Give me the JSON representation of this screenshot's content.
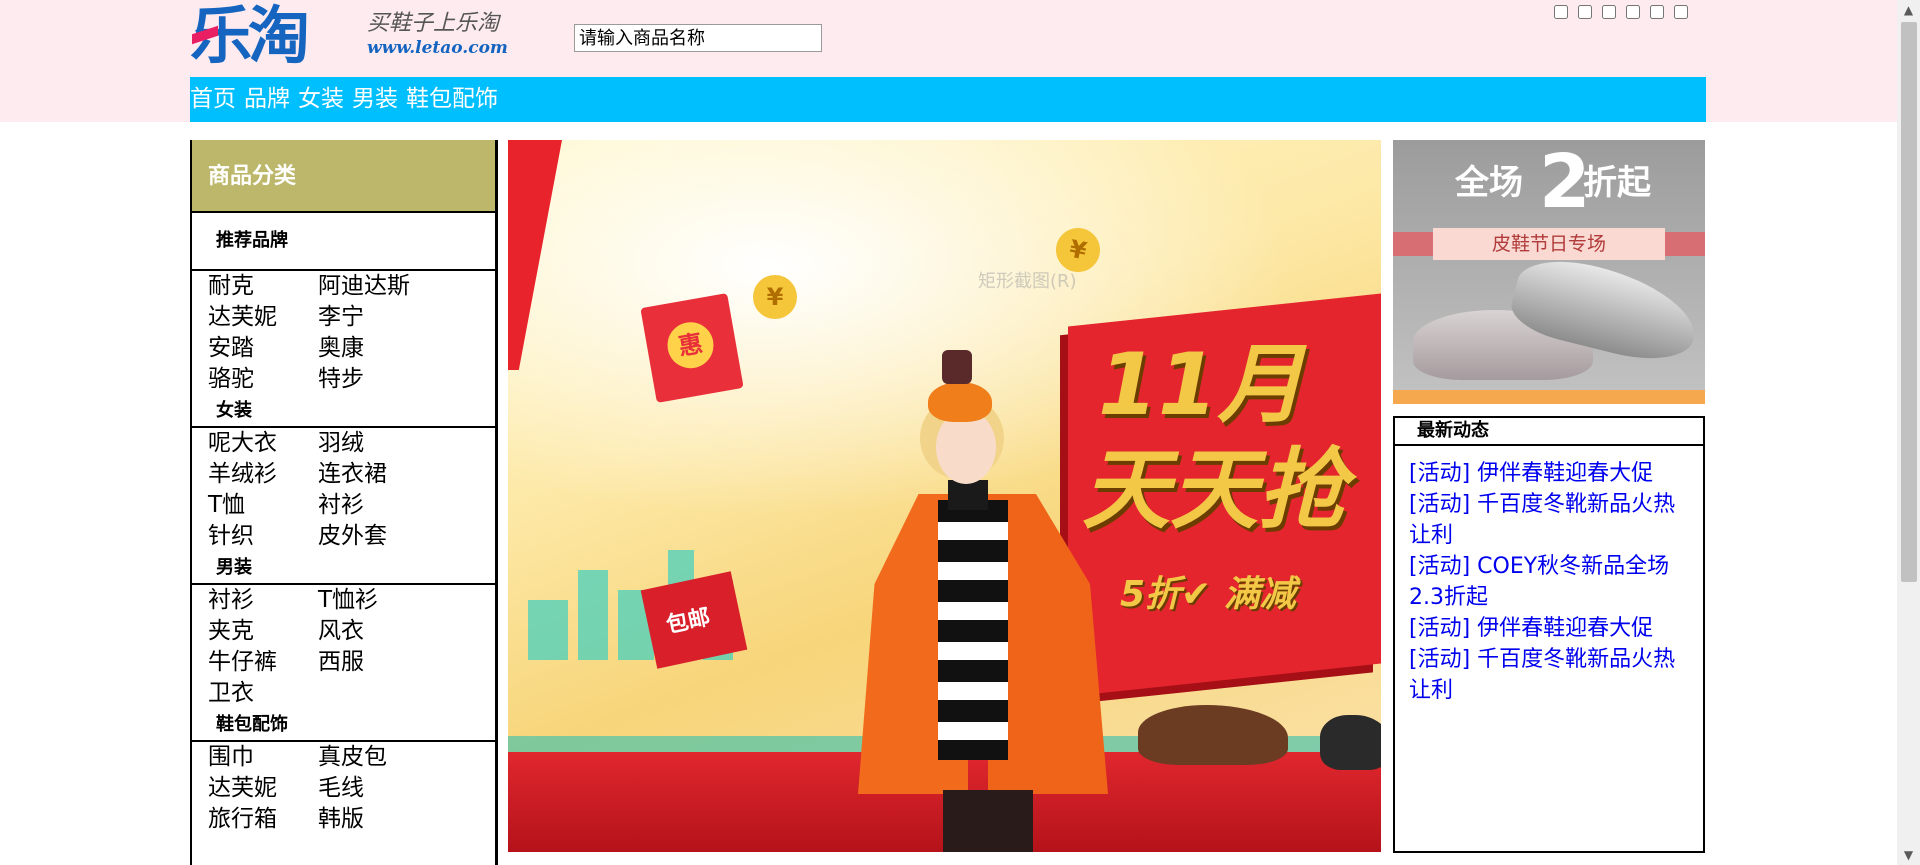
{
  "header": {
    "logo_text": "乐淘",
    "slogan_cn": "买鞋子上乐淘",
    "slogan_url": "www.letao.com",
    "search_placeholder": "请输入商品名称",
    "checkbox_count": 6
  },
  "nav": {
    "items": [
      "首页",
      "品牌",
      "女装",
      "男装",
      "鞋包配饰"
    ],
    "bg_color": "#00bfff"
  },
  "category": {
    "title": "商品分类",
    "title_bg": "#bdb76b",
    "sections": [
      {
        "title": "推荐品牌",
        "items": [
          "耐克",
          "阿迪达斯",
          "达芙妮",
          "李宁",
          "安踏",
          "奥康",
          "骆驼",
          "特步"
        ]
      },
      {
        "title": "女装",
        "items": [
          "呢大衣",
          "羽绒",
          "羊绒衫",
          "连衣裙",
          "T恤",
          "衬衫",
          "针织",
          "皮外套"
        ]
      },
      {
        "title": "男装",
        "items": [
          "衬衫",
          "T恤衫",
          "夹克",
          "风衣",
          "牛仔裤",
          "西服",
          "卫衣"
        ]
      },
      {
        "title": "鞋包配饰",
        "items": [
          "围巾",
          "真皮包",
          "达芙妮",
          "毛线",
          "旅行箱",
          "韩版"
        ]
      }
    ]
  },
  "banner": {
    "line1": "11月",
    "line2": "天天抢",
    "line3": "5折✔ 满减",
    "badge_hui": "惠",
    "badge_baoyou": "包邮",
    "coin_symbol": "¥",
    "watermark": "矩形截图(R)"
  },
  "promo": {
    "headline_left": "全场",
    "headline_num": "2",
    "headline_right": "折起",
    "ribbon": "皮鞋节日专场"
  },
  "news": {
    "title": "最新动态",
    "items": [
      "[活动] 伊伴春鞋迎春大促",
      "[活动] 千百度冬靴新品火热让利",
      "[活动] COEY秋冬新品全场2.3折起",
      "[活动] 伊伴春鞋迎春大促",
      "[活动] 千百度冬靴新品火热让利"
    ],
    "link_color": "#0000ee"
  },
  "scrollbar": {
    "up": "▲",
    "down": "▼"
  }
}
